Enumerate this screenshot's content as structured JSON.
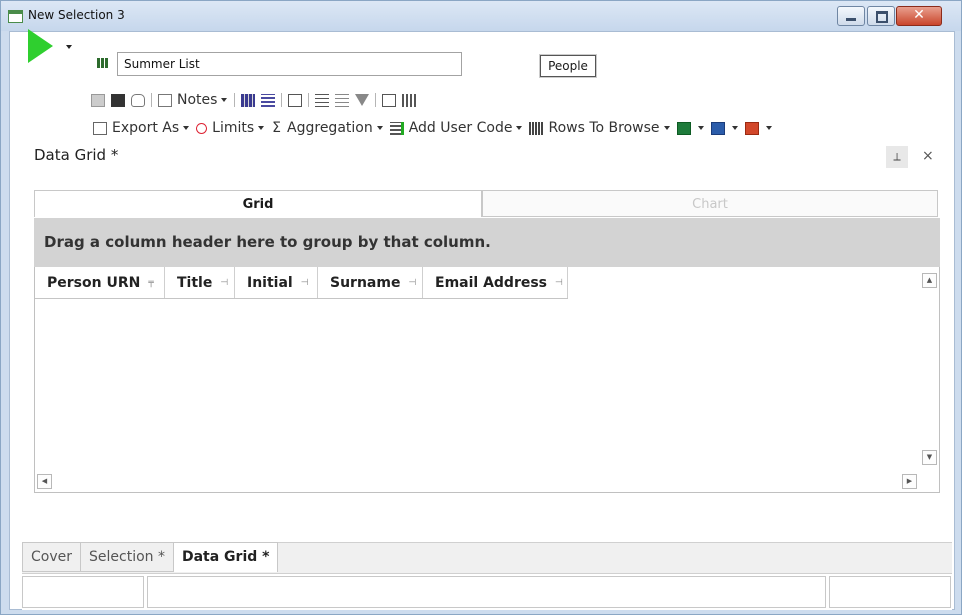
{
  "window": {
    "title": "New Selection 3",
    "close_glyph": "✕"
  },
  "toolbar": {
    "selection_name": "Summer List",
    "people_label": "People",
    "notes_label": "Notes",
    "export_label": "Export As",
    "limits_label": "Limits",
    "aggregation_label": "Aggregation",
    "add_user_code_label": "Add User Code",
    "rows_to_browse_label": "Rows To Browse"
  },
  "pane": {
    "title": "Data Grid *",
    "pin_glyph": "⟂",
    "close_glyph": "×"
  },
  "view_tabs": [
    {
      "label": "Grid",
      "active": true
    },
    {
      "label": "Chart",
      "active": false
    }
  ],
  "grid": {
    "group_hint": "Drag a column header here to group by that column.",
    "columns": [
      {
        "label": "Person URN"
      },
      {
        "label": "Title"
      },
      {
        "label": "Initial"
      },
      {
        "label": "Surname"
      },
      {
        "label": "Email Address"
      }
    ],
    "rows": []
  },
  "bottom_tabs": [
    {
      "label": "Cover"
    },
    {
      "label": "Selection *"
    },
    {
      "label": "Data Grid *"
    }
  ],
  "colors": {
    "run": "#2fcf2f",
    "titlebar": "#c6d7ec"
  }
}
